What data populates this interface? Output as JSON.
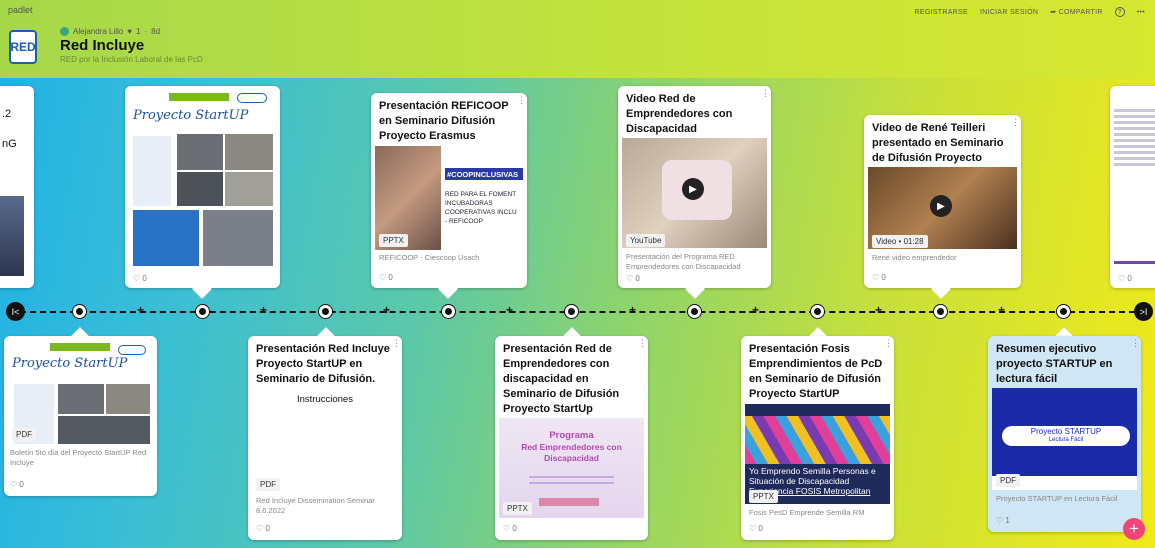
{
  "app": {
    "brand": "padlet",
    "actions": [
      "REGISTRARSE",
      "INICIAR SESIÓN",
      "COMPARTIR"
    ],
    "help_icon": "?",
    "more_icon": "•••"
  },
  "board": {
    "logo": "RED",
    "author": "Alejandra Lillo",
    "votes": "1",
    "age": "8d",
    "title": "Red Incluye",
    "subtitle": "RED por la Inclusión Laboral de las PcD"
  },
  "top_cards": [
    {
      "title": "",
      "badge": "",
      "caption": "",
      "likes": "0",
      "partial_text": [
        ".2",
        "nG"
      ]
    },
    {
      "title": "",
      "heading": "Proyecto StartUP",
      "badge": "",
      "caption": "",
      "likes": "0"
    },
    {
      "title": "Presentación REFICOOP en Seminario Difusión Proyecto Erasmus",
      "badge": "PPTX",
      "caption": "REFICOOP - Ciescoop Usach",
      "likes": "0",
      "thumb_text": [
        "#COOPINCLUSIVAS",
        "RED PARA EL FOMENT",
        "INCUBADORAS",
        "COOPERATIVAS INCLU",
        "- REFICOOP"
      ]
    },
    {
      "title": "Video Red de Emprendedores con Discapacidad",
      "badge": "YouTube",
      "caption": "Presentación del Programa RED Emprendedores con Discapacidad",
      "likes": "0"
    },
    {
      "title": "Video de René Teilleri presentado en Seminario de Difusión Proyecto StartUP",
      "badge": "Video • 01:28",
      "caption": "René video emprendedor",
      "likes": "0"
    },
    {
      "title": "",
      "badge": "",
      "caption": "",
      "likes": "0"
    }
  ],
  "bottom_cards": [
    {
      "title": "",
      "heading": "Proyecto StartUP",
      "badge": "PDF",
      "caption": "Boletín 5to día del Proyecto StartUP Red Incluye",
      "likes": "0"
    },
    {
      "title": "Presentación Red Incluye Proyecto StartUP en Seminario de Difusión.",
      "body": "Instrucciones",
      "badge": "PDF",
      "caption": "Red Incluye Dissemination Seminar 8.6.2022",
      "likes": "0"
    },
    {
      "title": "Presentación Red de Emprendedores con discapacidad en Seminario de Difusión Proyecto StartUp",
      "badge": "PPTX",
      "caption": "",
      "likes": "0",
      "thumb_text": [
        "Programa",
        "Red Emprendedores con",
        "Discapacidad"
      ]
    },
    {
      "title": "Presentación Fosis Emprendimientos de PcD en Seminario de Difusión Proyecto StartUP",
      "badge": "PPTX",
      "caption": "Fosis PesD Emprende Semilla RM",
      "likes": "0",
      "thumb_text": [
        "Yo Emprendo Semilla Personas e",
        "Situación de Discapacidad",
        "Experiencia FOSIS Metropolitan"
      ]
    },
    {
      "title": "Resumen ejecutivo proyecto STARTUP en lectura fácil",
      "badge": "PDF",
      "caption": "Proyecto STARTUP en Lectura Fácil",
      "likes": "1",
      "thumb_text": [
        "Proyecto STARTUP",
        "Lectura Fácil"
      ]
    }
  ],
  "timeline": {
    "prev": "I<",
    "next": ">I"
  },
  "fab": "+"
}
